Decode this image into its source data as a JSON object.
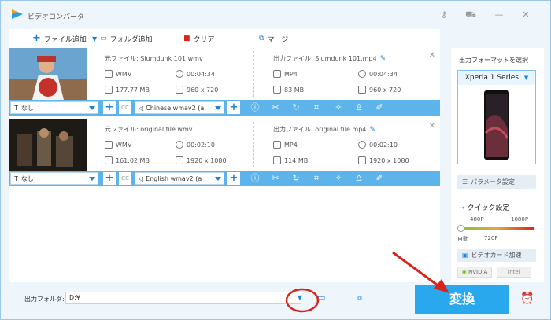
{
  "window": {
    "title": "ビデオコンバータ"
  },
  "toolbar": {
    "add_file": "ファイル追加",
    "add_folder": "フォルダ追加",
    "clear": "クリア",
    "merge": "マージ"
  },
  "files": [
    {
      "source_label": "元ファイル: Slumdunk 101.wmv",
      "src_format": "WMV",
      "src_duration": "00:04:34",
      "src_size": "177.77 MB",
      "src_resolution": "960 x 720",
      "output_label": "出力ファイル: Slumdunk 101.mp4",
      "out_format": "MP4",
      "out_duration": "00:04:34",
      "out_size": "83 MB",
      "out_resolution": "960 x 720",
      "subtitle": "なし",
      "audio": "Chinese wmav2 (a"
    },
    {
      "source_label": "元ファイル: original file.wmv",
      "src_format": "WMV",
      "src_duration": "00:02:10",
      "src_size": "161.02 MB",
      "src_resolution": "1920 x 1080",
      "output_label": "出力ファイル: original file.mp4",
      "out_format": "MP4",
      "out_duration": "00:02:10",
      "out_size": "114 MB",
      "out_resolution": "1920 x 1080",
      "subtitle": "なし",
      "audio": "English wmav2 (a"
    }
  ],
  "sidebar": {
    "format_header": "出力フォーマットを選択",
    "device": "Xperia 1 Series",
    "params": "パラメータ設定",
    "quick": "クイック設定",
    "q480": "480P",
    "q1080": "1080P",
    "auto": "自動",
    "q720": "720P",
    "gpu_accel": "ビデオカード加速",
    "nvidia": "NVIDIA",
    "intel": "intel",
    "colors": {
      "accent": "#2aa8ee",
      "bar": "#5cb4ea",
      "arrow": "#d8241b"
    }
  },
  "bottom": {
    "folder_label": "出力フォルダ:",
    "folder_value": "D:¥",
    "convert": "変換"
  }
}
